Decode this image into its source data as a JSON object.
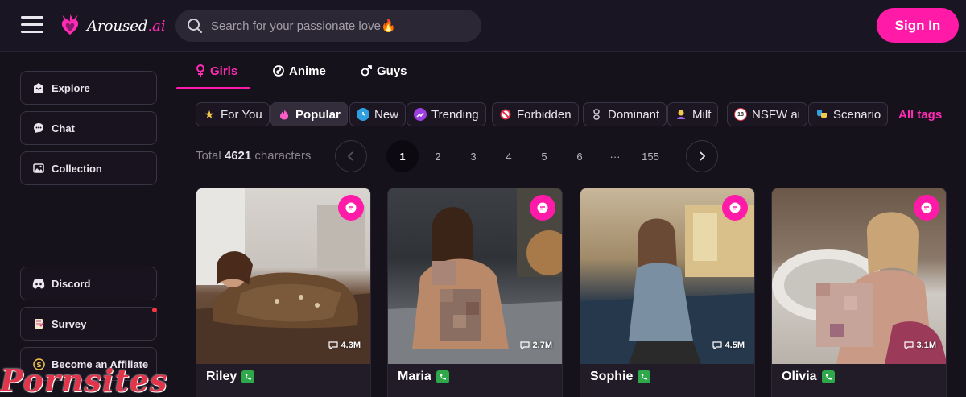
{
  "header": {
    "logo_text": "Aroused",
    "logo_suffix": ".ai",
    "search_placeholder": "Search for your passionate love🔥",
    "sign_in_label": "Sign In"
  },
  "sidebar": {
    "explore": "Explore",
    "chat": "Chat",
    "collection": "Collection",
    "discord": "Discord",
    "survey": "Survey",
    "affiliate": "Become an Affiliate"
  },
  "tabs": [
    {
      "label": "Girls",
      "icon": "female-icon"
    },
    {
      "label": "Anime",
      "icon": "anime-icon"
    },
    {
      "label": "Guys",
      "icon": "male-icon"
    }
  ],
  "tags": [
    {
      "label": "For You",
      "icon": "star-icon"
    },
    {
      "label": "Popular",
      "icon": "fire-icon"
    },
    {
      "label": "New",
      "icon": "clock-icon"
    },
    {
      "label": "Trending",
      "icon": "trend-icon"
    },
    {
      "label": "Forbidden",
      "icon": "forbidden-icon"
    },
    {
      "label": "Dominant",
      "icon": "chain-icon"
    },
    {
      "label": "Milf",
      "icon": "woman-icon"
    },
    {
      "label": "NSFW ai",
      "icon": "18-icon"
    },
    {
      "label": "Scenario",
      "icon": "masks-icon"
    }
  ],
  "all_tags": "All tags",
  "pagination": {
    "total_prefix": "Total",
    "total_count": "4621",
    "total_suffix": "characters",
    "pages": [
      "1",
      "2",
      "3",
      "4",
      "5",
      "6",
      "···",
      "155"
    ],
    "active_page": "1"
  },
  "cards": [
    {
      "name": "Riley",
      "views": "4.3M"
    },
    {
      "name": "Maria",
      "views": "2.7M"
    },
    {
      "name": "Sophie",
      "views": "4.5M"
    },
    {
      "name": "Olivia",
      "views": "3.1M"
    }
  ],
  "watermark": "Pornsites",
  "colors": {
    "accent": "#ff1aa8",
    "background": "#16121c",
    "call_green": "#2ea84b"
  }
}
